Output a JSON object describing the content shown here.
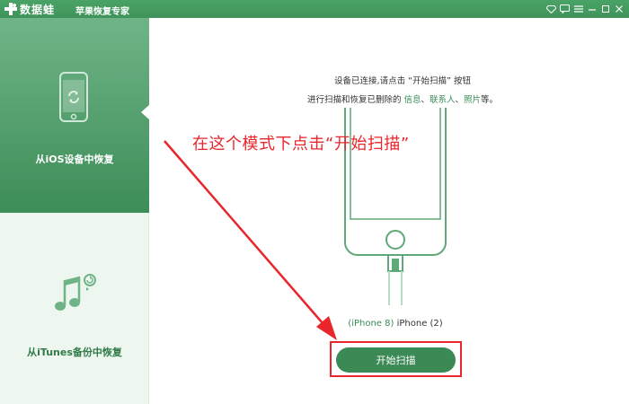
{
  "titlebar": {
    "brand": "数据蛙",
    "product": "苹果恢复专家",
    "icons": [
      "diamond-icon",
      "chat-icon",
      "menu-icon",
      "minimize-icon",
      "maximize-icon",
      "close-icon"
    ]
  },
  "sidebar": {
    "items": [
      {
        "label": "从iOS设备中恢复",
        "icon": "iphone-restore-icon",
        "active": true
      },
      {
        "label": "从iTunes备份中恢复",
        "icon": "itunes-icon",
        "active": false
      }
    ]
  },
  "main": {
    "instruction_line1": "设备已连接,请点击 “开始扫描” 按钮",
    "instruction_line2_prefix": "进行扫描和恢复已删除的 ",
    "link_messages": "信息",
    "sep1": "、",
    "link_contacts": "联系人",
    "sep2": "、",
    "link_photos": "照片",
    "instruction_line2_suffix": "等。",
    "annotation": "在这个模式下点击“开始扫描”",
    "device_model": "(iPhone 8)",
    "device_name": " iPhone (2)",
    "scan_button": "开始扫描"
  },
  "colors": {
    "brand_green": "#3f935a",
    "annotation_red": "#e8262b"
  }
}
